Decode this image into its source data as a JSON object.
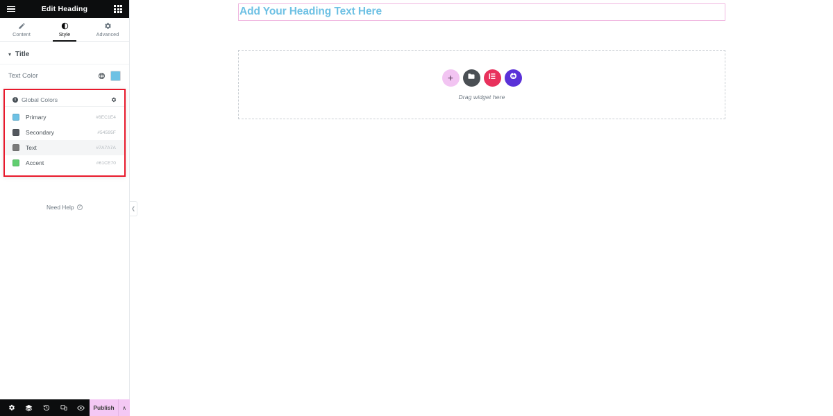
{
  "panel": {
    "header": {
      "title": "Edit Heading",
      "menu_icon": "hamburger-menu-icon",
      "apps_icon": "grid-apps-icon"
    },
    "tabs": [
      {
        "label": "Content",
        "icon": "pencil-icon",
        "active": false
      },
      {
        "label": "Style",
        "icon": "contrast-circle-icon",
        "active": true
      },
      {
        "label": "Advanced",
        "icon": "gear-icon",
        "active": false
      }
    ],
    "section": {
      "title": "Title",
      "caret": "▾"
    },
    "text_color_control": {
      "label": "Text Color",
      "globe_icon": "globe-icon",
      "swatch_value": "#6EC1E4"
    },
    "global_colors": {
      "title": "Global Colors",
      "info_icon": "info-icon",
      "settings_icon": "gear-icon",
      "items": [
        {
          "name": "Primary",
          "hex": "#6EC1E4",
          "swatch": "#6EC1E4",
          "highlighted": false
        },
        {
          "name": "Secondary",
          "hex": "#54595F",
          "swatch": "#54595F",
          "highlighted": false
        },
        {
          "name": "Text",
          "hex": "#7A7A7A",
          "swatch": "#7A7A7A",
          "highlighted": true
        },
        {
          "name": "Accent",
          "hex": "#61CE70",
          "swatch": "#61CE70",
          "highlighted": false
        }
      ]
    },
    "need_help": {
      "label": "Need Help",
      "icon": "question-circle-icon"
    },
    "collapse_handle": {
      "icon": "chevron-left-icon"
    },
    "footer": {
      "icons": [
        {
          "name": "settings-icon"
        },
        {
          "name": "layers-navigator-icon"
        },
        {
          "name": "history-icon"
        },
        {
          "name": "responsive-mode-icon"
        },
        {
          "name": "preview-eye-icon"
        }
      ],
      "publish_label": "Publish",
      "publish_caret": "∧",
      "publish_color": "#F4C8F4"
    }
  },
  "canvas": {
    "heading": {
      "text": "Add Your Heading Text Here",
      "color": "#6EC1E4",
      "outline_color": "#F0B6E0"
    },
    "dropzone": {
      "caption": "Drag widget here",
      "buttons": [
        {
          "name": "add-element-button",
          "icon": "plus-icon",
          "color": "#F2C4F2"
        },
        {
          "name": "add-template-button",
          "icon": "folder-icon",
          "color": "#4A4F54"
        },
        {
          "name": "elementor-library-button",
          "icon": "elementor-icon",
          "color": "#E8315C"
        },
        {
          "name": "ai-builder-button",
          "icon": "ai-robot-icon",
          "color": "#5A31D8"
        }
      ]
    }
  }
}
